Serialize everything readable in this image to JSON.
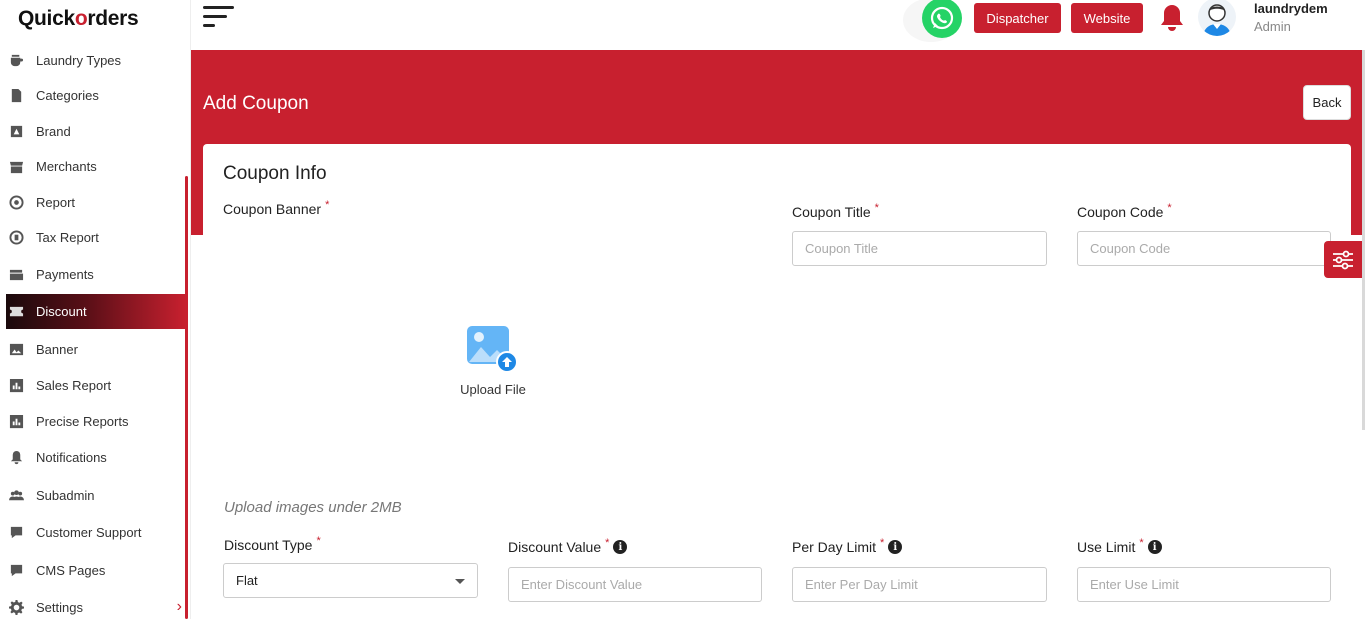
{
  "brand": {
    "logo_part1": "Quick",
    "logo_o": "o",
    "logo_part2": "rders",
    "accent": "#c8202f"
  },
  "sidebar": {
    "items": [
      {
        "label": "Laundry Types",
        "icon": "cup-icon"
      },
      {
        "label": "Categories",
        "icon": "document-icon"
      },
      {
        "label": "Brand",
        "icon": "brand-icon"
      },
      {
        "label": "Merchants",
        "icon": "store-icon"
      },
      {
        "label": "Report",
        "icon": "report-icon"
      },
      {
        "label": "Tax Report",
        "icon": "tax-icon"
      },
      {
        "label": "Payments",
        "icon": "wallet-icon"
      },
      {
        "label": "Discount",
        "icon": "discount-icon",
        "active": true
      },
      {
        "label": "Banner",
        "icon": "image-icon"
      },
      {
        "label": "Sales Report",
        "icon": "chart-icon"
      },
      {
        "label": "Precise Reports",
        "icon": "chart-icon"
      },
      {
        "label": "Notifications",
        "icon": "bell-icon"
      },
      {
        "label": "Subadmin",
        "icon": "users-icon"
      },
      {
        "label": "Customer Support",
        "icon": "chat-icon"
      },
      {
        "label": "CMS Pages",
        "icon": "code-chat-icon"
      },
      {
        "label": "Settings",
        "icon": "gear-icon",
        "has_submenu": true
      }
    ]
  },
  "header": {
    "dispatcher_label": "Dispatcher",
    "website_label": "Website",
    "user_name": "laundrydem",
    "user_role": "Admin"
  },
  "page": {
    "title": "Add Coupon",
    "back_label": "Back"
  },
  "form": {
    "section_title": "Coupon Info",
    "banner_label": "Coupon Banner",
    "upload_label": "Upload File",
    "upload_hint": "Upload images under 2MB",
    "coupon_title_label": "Coupon Title",
    "coupon_title_placeholder": "Coupon Title",
    "coupon_code_label": "Coupon Code",
    "coupon_code_placeholder": "Coupon Code",
    "discount_type_label": "Discount Type",
    "discount_type_value": "Flat",
    "discount_value_label": "Discount Value",
    "discount_value_placeholder": "Enter Discount Value",
    "per_day_limit_label": "Per Day Limit",
    "per_day_limit_placeholder": "Enter Per Day Limit",
    "use_limit_label": "Use Limit",
    "use_limit_placeholder": "Enter Use Limit",
    "required_mark": "*",
    "info_mark": "i"
  }
}
